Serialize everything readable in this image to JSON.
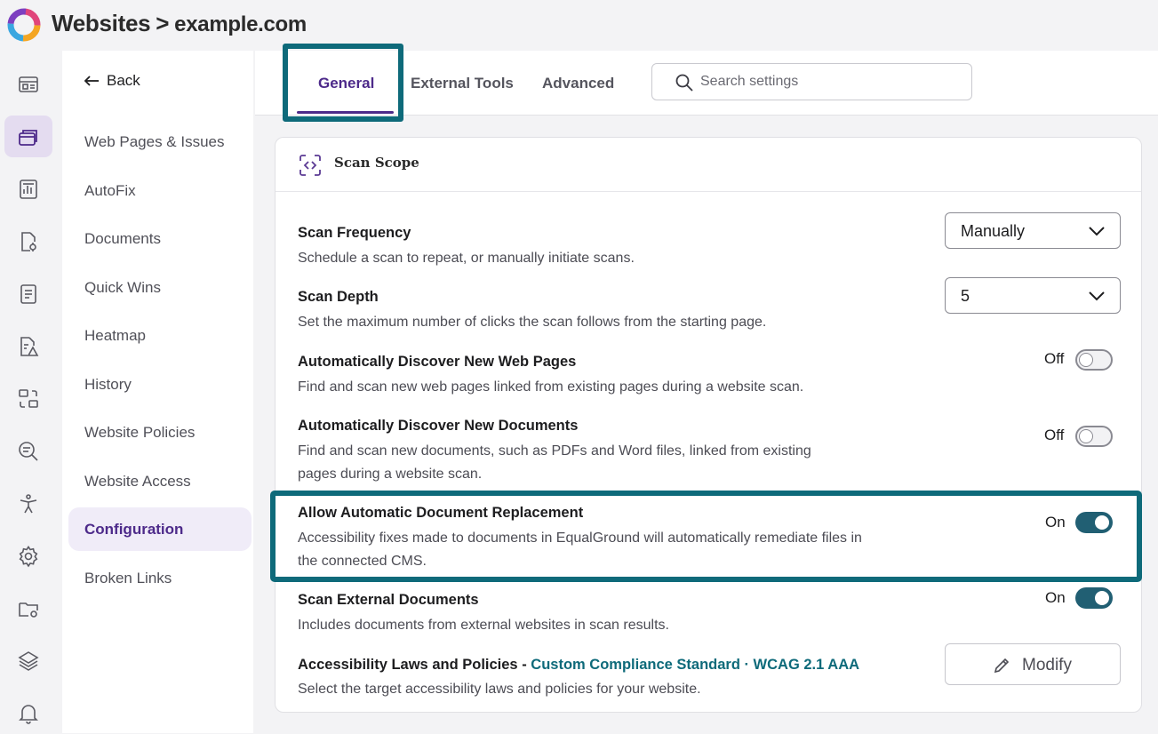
{
  "header": {
    "section": "Websites",
    "separator": ">",
    "site": "example.com"
  },
  "rail": {
    "icons": [
      "dashboard-icon",
      "websites-icon",
      "reports-icon",
      "document-settings-icon",
      "notes-icon",
      "document-alert-icon",
      "transform-icon",
      "search-analysis-icon",
      "accessibility-icon",
      "settings-icon",
      "folder-settings-icon",
      "layers-icon",
      "bell-icon"
    ],
    "active": "websites-icon"
  },
  "subnav": {
    "back_label": "Back",
    "items": [
      "Web Pages & Issues",
      "AutoFix",
      "Documents",
      "Quick Wins",
      "Heatmap",
      "History",
      "Website Policies",
      "Website Access",
      "Configuration",
      "Broken Links"
    ],
    "active_item": "Configuration"
  },
  "tabs": {
    "items": [
      "General",
      "External Tools",
      "Advanced"
    ],
    "active": "General"
  },
  "search": {
    "placeholder": "Search settings"
  },
  "card": {
    "title": "Scan Scope",
    "settings": {
      "scan_frequency": {
        "title": "Scan Frequency",
        "desc": "Schedule a scan to repeat, or manually initiate scans.",
        "value": "Manually"
      },
      "scan_depth": {
        "title": "Scan Depth",
        "desc": "Set the maximum number of clicks the scan follows from the starting page.",
        "value": "5"
      },
      "discover_pages": {
        "title": "Automatically Discover New Web Pages",
        "desc": "Find and scan new web pages linked from existing pages during a website scan.",
        "state": "Off"
      },
      "discover_docs": {
        "title": "Automatically Discover New Documents",
        "desc": "Find and scan new documents, such as PDFs and Word files, linked from existing pages during a website scan.",
        "state": "Off"
      },
      "doc_replacement": {
        "title": "Allow Automatic Document Replacement",
        "desc": "Accessibility fixes made to documents in EqualGround will automatically remediate files in the connected CMS.",
        "state": "On"
      },
      "external_docs": {
        "title": "Scan External Documents",
        "desc": "Includes documents from external websites in scan results.",
        "state": "On"
      },
      "laws": {
        "title": "Accessibility Laws and Policies - ",
        "link": "Custom Compliance Standard · WCAG 2.1 AAA",
        "desc": "Select the target accessibility laws and policies for your website.",
        "button": "Modify"
      }
    }
  },
  "colors": {
    "accent_purple": "#4d2a8a",
    "highlight_teal": "#0e6a7a",
    "toggle_on": "#215f73"
  }
}
